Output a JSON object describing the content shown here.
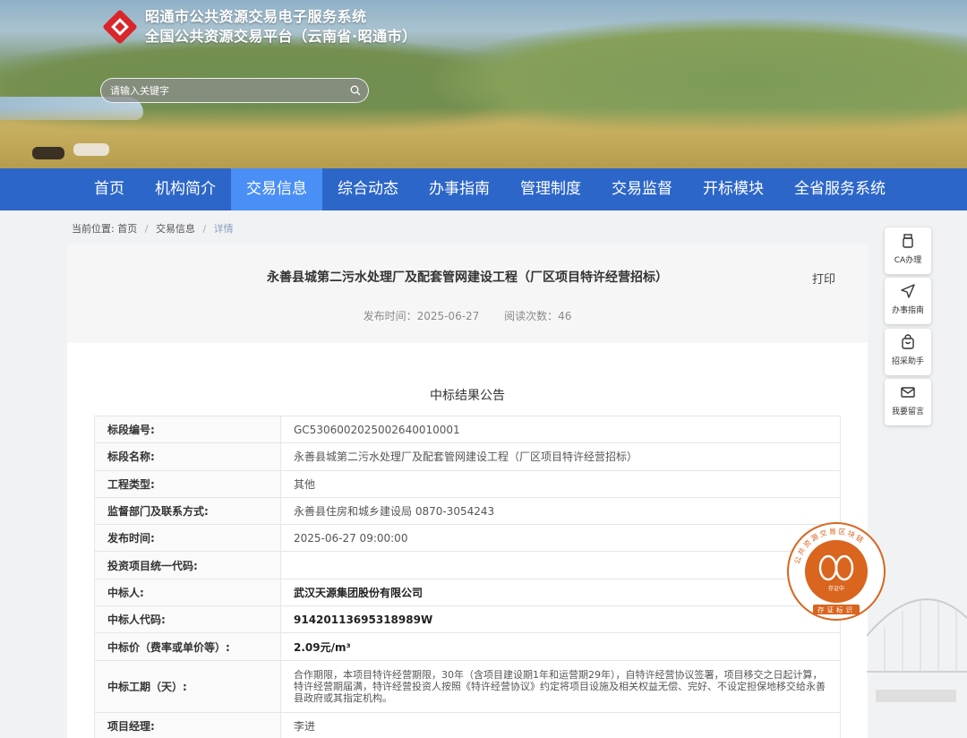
{
  "header": {
    "brand_line1": "昭通市公共资源交易电子服务系统",
    "brand_line2": "全国公共资源交易平台（云南省·昭通市）",
    "search_placeholder": "请输入关键字"
  },
  "nav": {
    "items": [
      "首页",
      "机构简介",
      "交易信息",
      "综合动态",
      "办事指南",
      "管理制度",
      "交易监督",
      "开标模块",
      "全省服务系统"
    ],
    "active": "交易信息"
  },
  "breadcrumb": {
    "prefix": "当前位置:",
    "items": [
      "首页",
      "交易信息",
      "详情"
    ]
  },
  "article": {
    "title": "永善县城第二污水处理厂及配套管网建设工程（厂区项目特许经营招标）",
    "print_label": "打印",
    "publish_label": "发布时间：2025-06-27",
    "views_label": "阅读次数：46",
    "subtitle": "中标结果公告"
  },
  "table": {
    "rows": [
      {
        "key": "标段编号:",
        "value": "GC5306002025002640010001"
      },
      {
        "key": "标段名称:",
        "value": "永善县城第二污水处理厂及配套管网建设工程（厂区项目特许经营招标）"
      },
      {
        "key": "工程类型:",
        "value": "其他"
      },
      {
        "key": "监督部门及联系方式:",
        "value": "永善县住房和城乡建设局 0870-3054243"
      },
      {
        "key": "发布时间:",
        "value": "2025-06-27 09:00:00"
      },
      {
        "key": "投资项目统一代码:",
        "value": ""
      },
      {
        "key": "中标人:",
        "value": "武汉天源集团股份有限公司"
      },
      {
        "key": "中标人代码:",
        "value": "91420113695318989W"
      },
      {
        "key": "中标价（费率或单价等）:",
        "value": "2.09元/m³"
      },
      {
        "key": "中标工期（天）:",
        "value": "合作期限，本项目特许经营期限，30年（含项目建设期1年和运营期29年），自特许经营协议签署，项目移交之日起计算，特许经营期届满，特许经营投资人按照《特许经营协议》约定将项目设施及相关权益无偿、完好、不设定担保地移交给永善县政府或其指定机构。"
      },
      {
        "key": "项目经理:",
        "value": "李进"
      }
    ]
  },
  "tools": [
    {
      "label": "CA办理",
      "icon": "usb-key-icon"
    },
    {
      "label": "办事指南",
      "icon": "send-icon"
    },
    {
      "label": "招采助手",
      "icon": "shopping-bag-icon"
    },
    {
      "label": "我要留言",
      "icon": "mail-icon"
    }
  ],
  "seal": {
    "top_text": "公共资源交易区块链",
    "middle_text": "存证中",
    "bottom_text": "存证标识"
  },
  "colors": {
    "nav_bg": "#2c66c9",
    "nav_active": "#4a8ff5",
    "seal": "#d9651e"
  }
}
